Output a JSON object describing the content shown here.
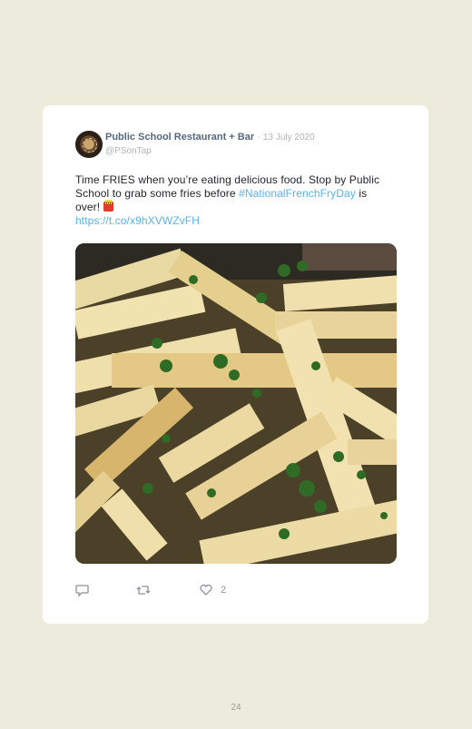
{
  "tweet": {
    "author_name": "Public School Restaurant + Bar",
    "separator": "·",
    "date": "13 July 2020",
    "handle": "@PSonTap",
    "text_part1": "Time FRIES when you’re eating delicious food. Stop by Public School to grab some fries before ",
    "hashtag": "#NationalFrenchFryDay",
    "text_part2": " is over! ",
    "link": "https://t.co/x9hXVWZvFH",
    "emoji_icon": "french-fries-icon",
    "image_description_icon": "fries-photo",
    "like_count": "2"
  },
  "actions": {
    "reply_icon": "reply-icon",
    "retweet_icon": "retweet-icon",
    "like_icon": "heart-icon"
  },
  "page": {
    "number": "24"
  },
  "colors": {
    "background": "#edecdc",
    "card": "#ffffff",
    "link": "#5bb1ea",
    "name": "#56687d",
    "muted": "#aeb5bd"
  }
}
